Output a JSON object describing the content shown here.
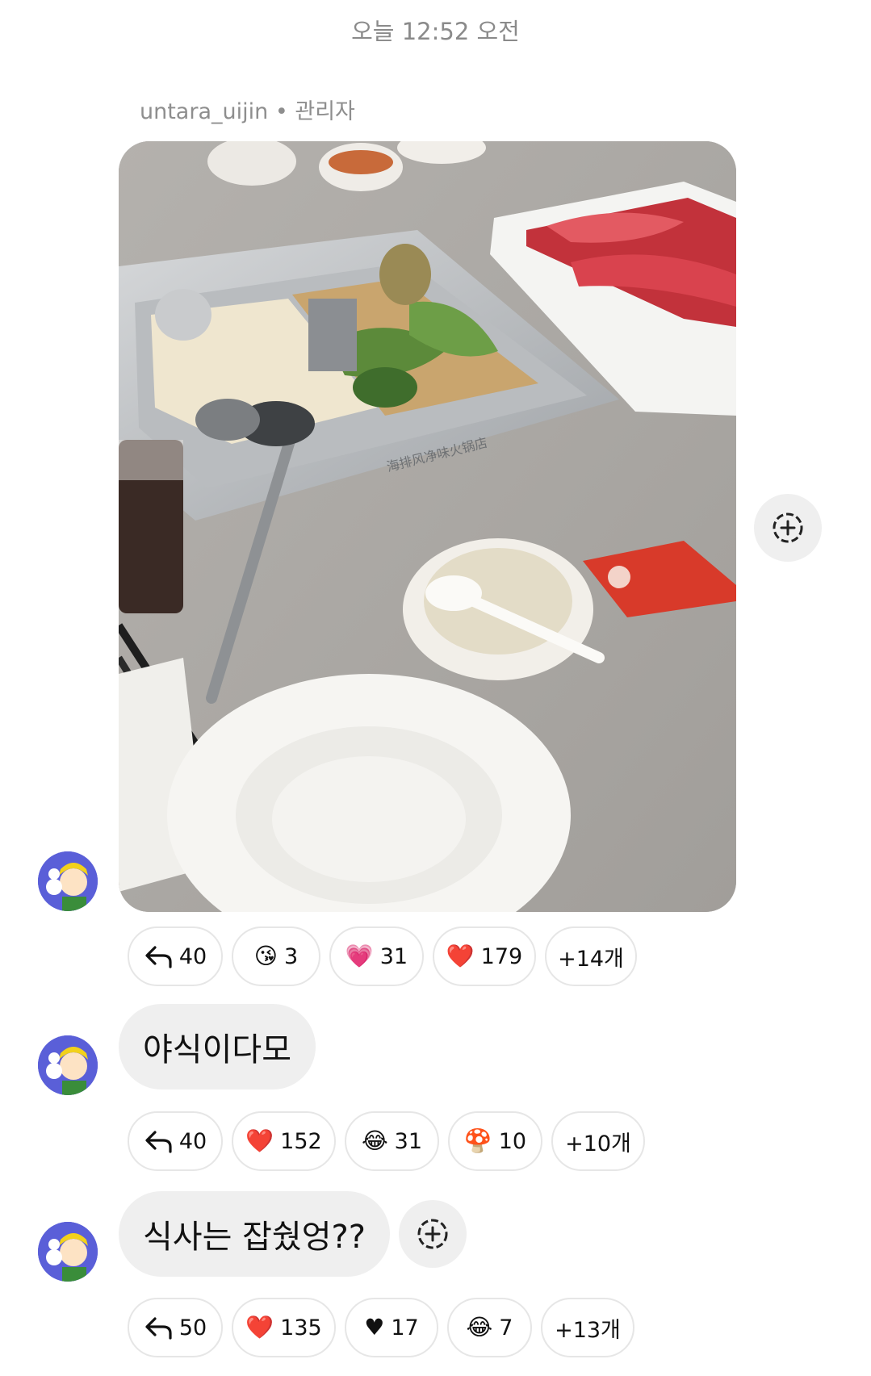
{
  "timestamp": "오늘 12:52 오전",
  "sender": {
    "name": "untara_uijin",
    "separator": "•",
    "role": "관리자"
  },
  "photo": {
    "printed_text": "海排风净味火锅店"
  },
  "messages": [
    {
      "type": "image",
      "reactions": [
        {
          "icon": "reply-arrow-icon",
          "label": "40"
        },
        {
          "icon": "kissing-face-emoji",
          "emoji": "😘",
          "label": "3"
        },
        {
          "icon": "pink-heart-emoji",
          "emoji": "💗",
          "label": "31"
        },
        {
          "icon": "red-heart-emoji",
          "emoji": "❤️",
          "label": "179"
        },
        {
          "label": "+14개"
        }
      ]
    },
    {
      "type": "text",
      "text": "야식이다모",
      "reactions": [
        {
          "icon": "reply-arrow-icon",
          "label": "40"
        },
        {
          "icon": "red-heart-emoji",
          "emoji": "❤️",
          "label": "152"
        },
        {
          "icon": "laughing-tears-emoji",
          "emoji": "😂",
          "label": "31"
        },
        {
          "icon": "mushroom-emoji",
          "emoji": "🍄",
          "label": "10"
        },
        {
          "label": "+10개"
        }
      ]
    },
    {
      "type": "text",
      "text": "식사는 잡쉈엉??",
      "reactions": [
        {
          "icon": "reply-arrow-icon",
          "label": "50"
        },
        {
          "icon": "red-heart-emoji",
          "emoji": "❤️",
          "label": "135"
        },
        {
          "icon": "black-heart-emoji",
          "emoji": "♥",
          "label": "17"
        },
        {
          "icon": "laughing-tears-emoji",
          "emoji": "😂",
          "label": "7"
        },
        {
          "label": "+13개"
        }
      ]
    }
  ],
  "colors": {
    "bubble": "#efefef",
    "meta_text": "#8a8a8a",
    "avatar_bg": "#5a5fd8"
  }
}
